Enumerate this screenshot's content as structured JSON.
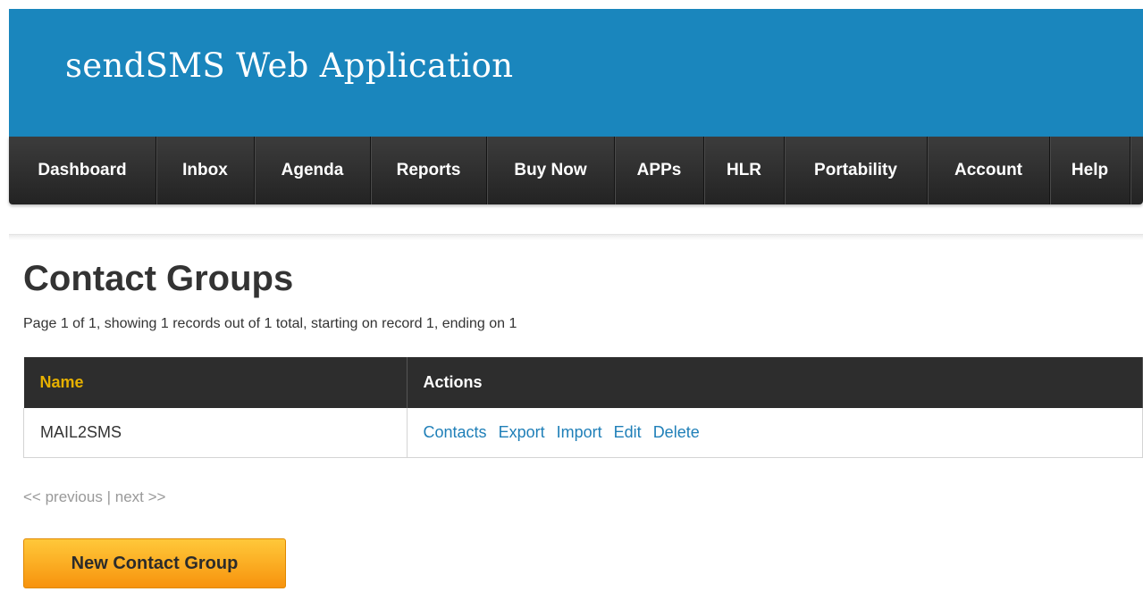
{
  "header": {
    "title": "sendSMS Web Application",
    "bg_color": "#1a86bd"
  },
  "nav": {
    "items": [
      {
        "label": "Dashboard"
      },
      {
        "label": "Inbox"
      },
      {
        "label": "Agenda"
      },
      {
        "label": "Reports"
      },
      {
        "label": "Buy Now"
      },
      {
        "label": "APPs"
      },
      {
        "label": "HLR"
      },
      {
        "label": "Portability"
      },
      {
        "label": "Account"
      },
      {
        "label": "Help"
      }
    ]
  },
  "main": {
    "title": "Contact Groups",
    "summary": "Page 1 of 1, showing 1 records out of 1 total, starting on record 1, ending on 1",
    "table": {
      "columns": [
        "Name",
        "Actions"
      ],
      "rows": [
        {
          "name": "MAIL2SMS",
          "actions": [
            "Contacts",
            "Export",
            "Import",
            "Edit",
            "Delete"
          ]
        }
      ]
    },
    "pager": {
      "previous": "<< previous",
      "separator": "|",
      "next": "next >>"
    },
    "new_button": "New Contact Group"
  },
  "colors": {
    "accent": "#1a86bd",
    "link": "#1f7fb8",
    "button": "#f7a21b",
    "name_header": "#e6b000"
  }
}
